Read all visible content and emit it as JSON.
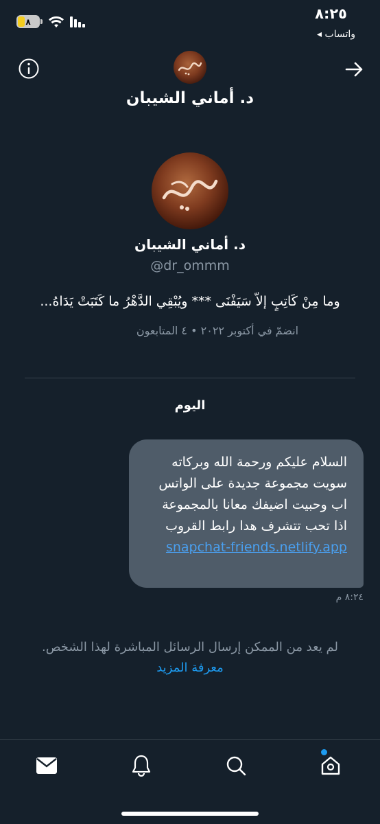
{
  "status": {
    "time": "٨:٢٥",
    "back_app": "◂ واتساب",
    "battery": "٨"
  },
  "header": {
    "name": "د. أماني الشيبان",
    "info_icon": "info-icon",
    "back_icon": "arrow-right-icon"
  },
  "profile": {
    "name": "د. أماني الشيبان",
    "handle": "@dr_ommm",
    "bio": "وما مِنْ كَاتِبٍ إلاّ سَيَفْنَى *** ويُبْقِي الدَّهْرُ ما كَتَبَتْ يَدَاهُ...",
    "meta": "انضمّ في أكتوبر ٢٠٢٢ • ٤ المتابعون"
  },
  "conversation": {
    "day_label": "اليوم",
    "message": {
      "text": "السلام عليكم ورحمة الله وبركاته سويت مجموعة جديدة على الواتس اب وحبيت اضيفك معانا بالمجموعة اذا تحب تتشرف هدا رابط القروب ",
      "link": "snapchat-friends.netlify.app",
      "time": "٨:٢٤ م"
    },
    "notice": "لم يعد من الممكن إرسال الرسائل المباشرة لهذا الشخص.",
    "notice_link": "معرفة المزيد"
  },
  "nav": {
    "items": [
      "messages-icon",
      "notifications-icon",
      "search-icon",
      "home-icon"
    ]
  },
  "colors": {
    "background": "#15202b",
    "bubble": "#4f5c69",
    "accent": "#1d9bf0",
    "muted": "#8b98a5"
  }
}
